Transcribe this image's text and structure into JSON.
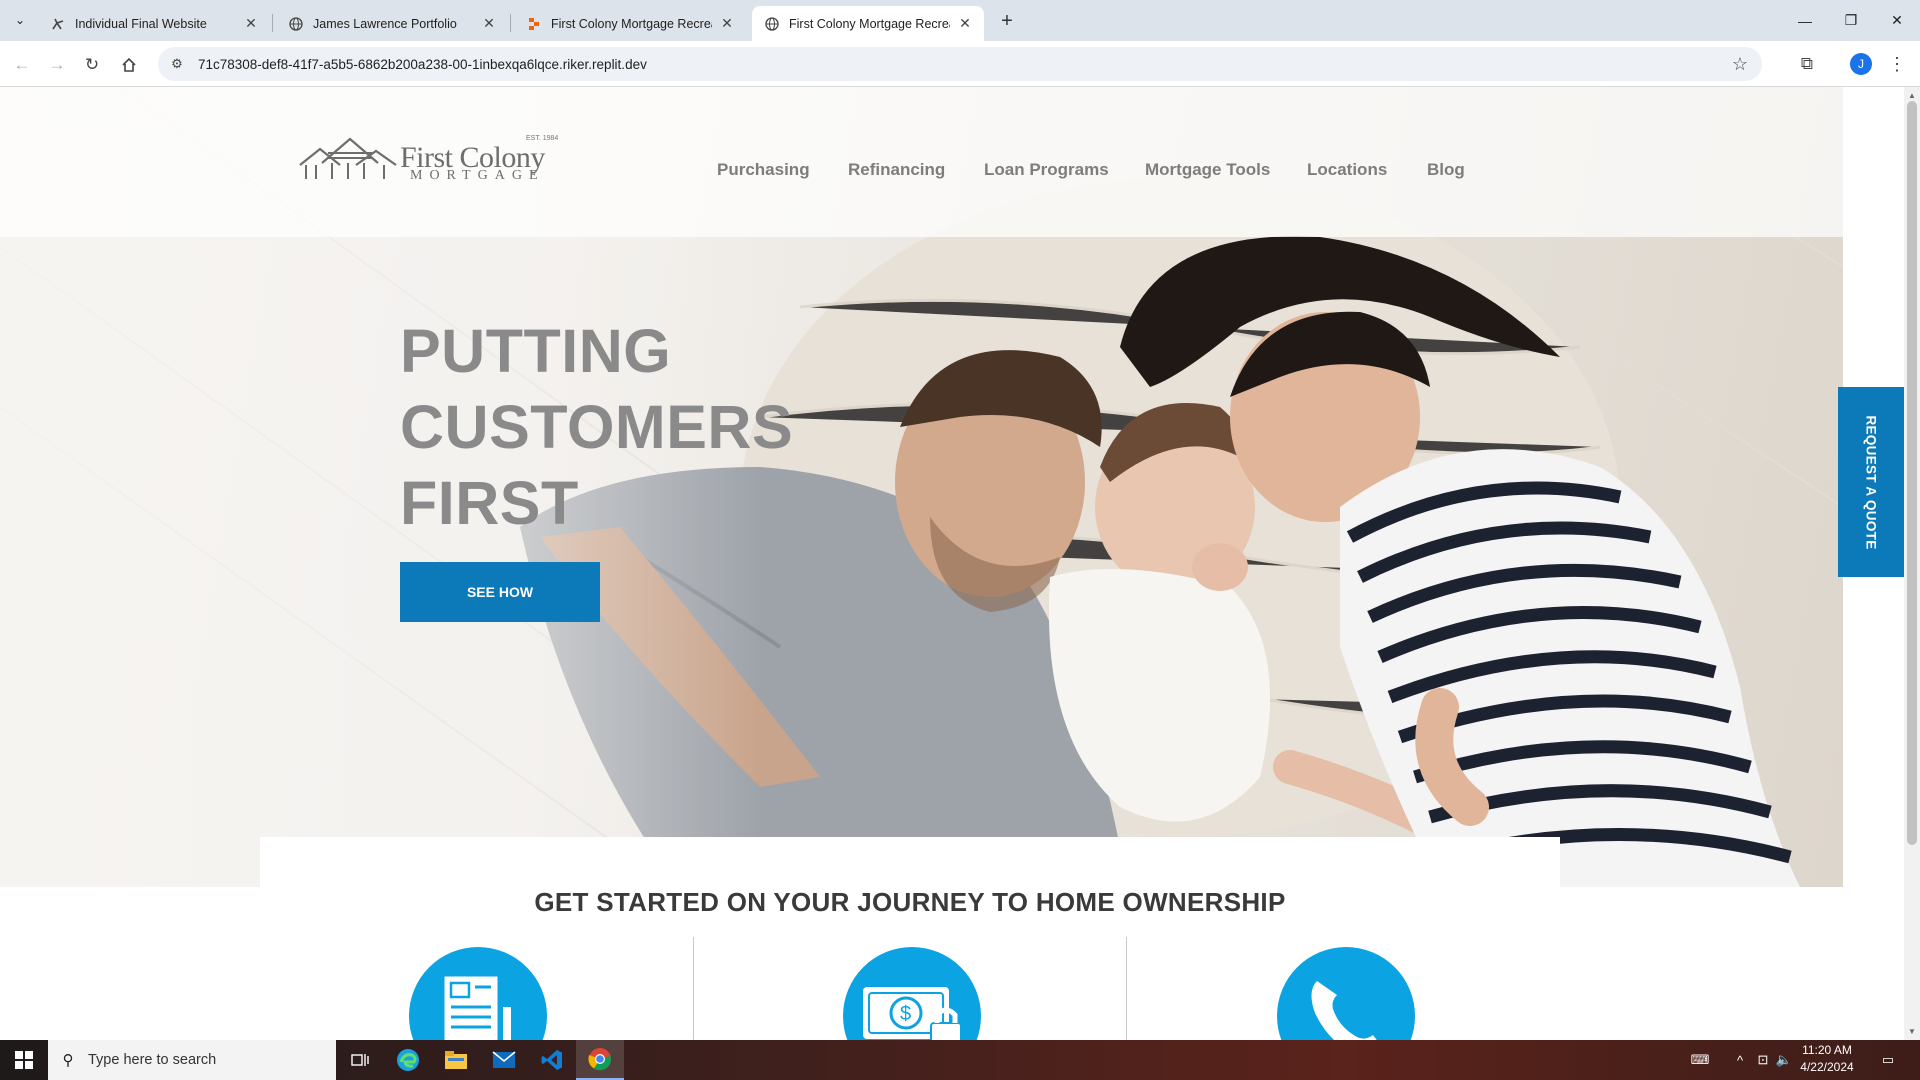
{
  "browser": {
    "tabs": [
      {
        "title": "Individual Final Website",
        "icon": "replit-icon",
        "active": false
      },
      {
        "title": "James Lawrence Portfolio",
        "icon": "globe-icon",
        "active": false
      },
      {
        "title": "First Colony Mortgage Recreat",
        "icon": "replit-icon",
        "active": false
      },
      {
        "title": "First Colony Mortgage Recreat",
        "icon": "globe-icon",
        "active": true
      }
    ],
    "url": "71c78308-def8-41f7-a5b5-6862b200a238-00-1inbexqa6lqce.riker.replit.dev",
    "profile_initial": "J"
  },
  "site": {
    "logo": {
      "name": "First Colony",
      "sub": "MORTGAGE",
      "est": "EST. 1984"
    },
    "nav": [
      "Purchasing",
      "Refinancing",
      "Loan Programs",
      "Mortgage Tools",
      "Locations",
      "Blog"
    ],
    "hero": {
      "headline": [
        "PUTTING",
        "CUSTOMERS",
        "FIRST"
      ],
      "cta": "SEE HOW"
    },
    "quote_tab": "REQUEST A QUOTE",
    "journey_heading": "GET STARTED ON YOUR JOURNEY TO HOME OWNERSHIP",
    "journey_icons": [
      "document-icon",
      "money-lock-icon",
      "phone-icon"
    ],
    "accent_color": "#0c79b8",
    "icon_circle_color": "#0ca3e3"
  },
  "taskbar": {
    "search_placeholder": "Type here to search",
    "time": "11:20 AM",
    "date": "4/22/2024"
  }
}
